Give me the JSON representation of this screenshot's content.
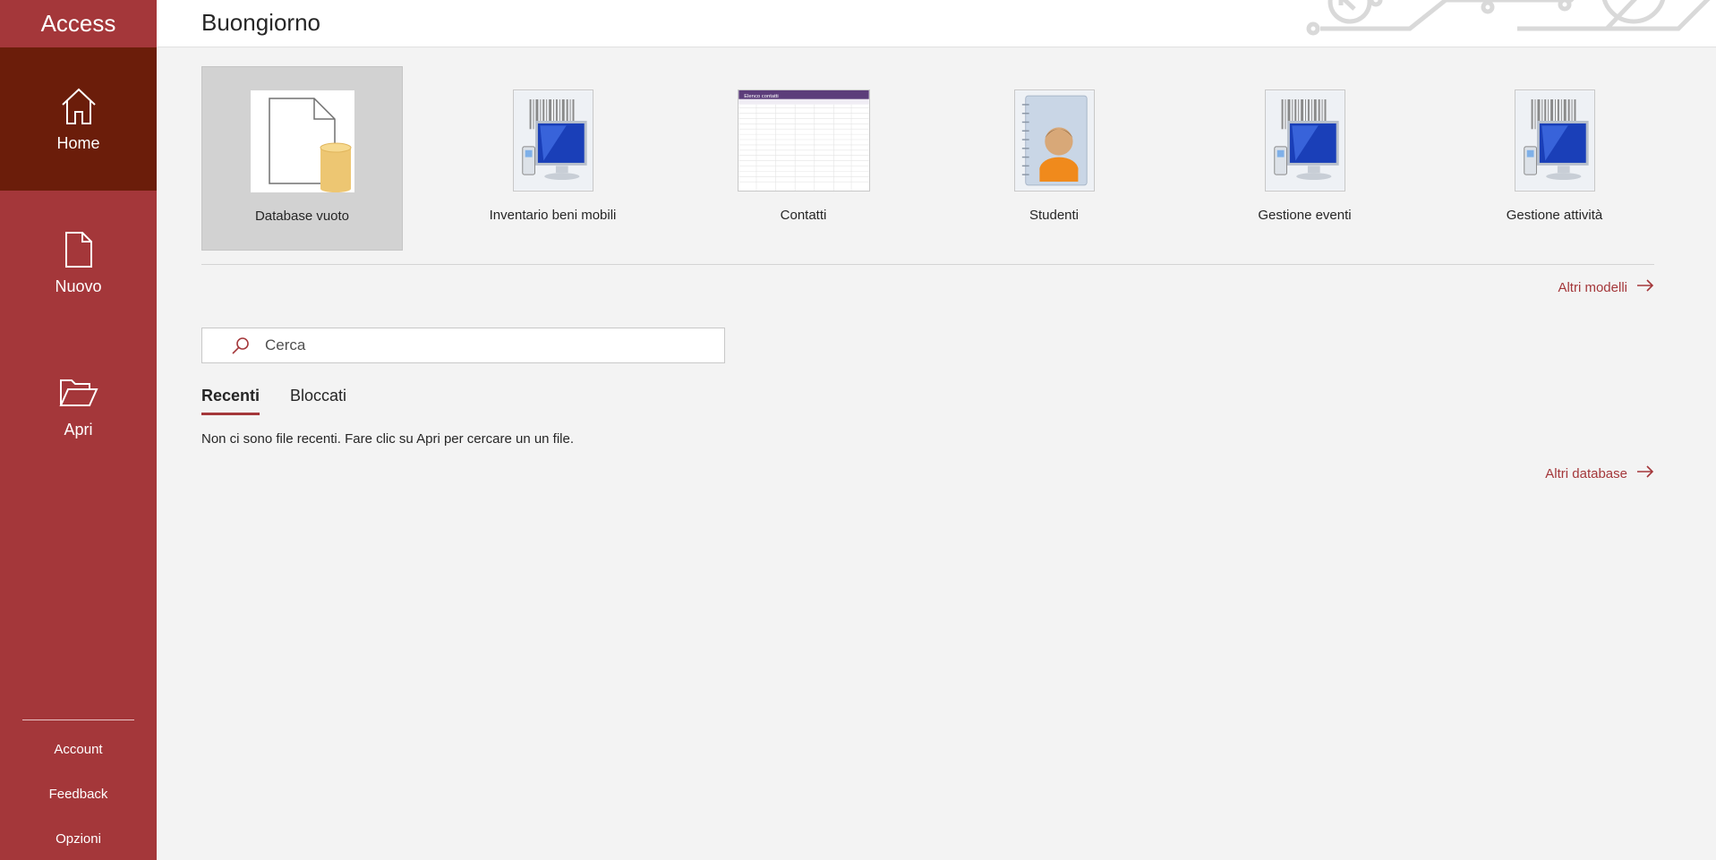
{
  "app": {
    "title": "Access"
  },
  "nav": {
    "home": "Home",
    "new": "Nuovo",
    "open": "Apri"
  },
  "sidebar_footer": {
    "account": "Account",
    "feedback": "Feedback",
    "options": "Opzioni"
  },
  "header": {
    "greeting": "Buongiorno"
  },
  "templates": [
    {
      "label": "Database vuoto",
      "icon": "blank-database-icon"
    },
    {
      "label": "Inventario beni mobili",
      "icon": "barcode-computer-icon"
    },
    {
      "label": "Contatti",
      "icon": "contacts-table-icon",
      "thumb_title": "Elenco contatti"
    },
    {
      "label": "Studenti",
      "icon": "student-notebook-icon"
    },
    {
      "label": "Gestione eventi",
      "icon": "barcode-computer-icon"
    },
    {
      "label": "Gestione attività",
      "icon": "barcode-computer-icon"
    }
  ],
  "links": {
    "more_templates": "Altri modelli",
    "more_databases": "Altri database"
  },
  "search": {
    "placeholder": "Cerca",
    "value": ""
  },
  "tabs": {
    "recent": "Recenti",
    "pinned": "Bloccati"
  },
  "recent": {
    "empty_message": "Non ci sono file recenti. Fare clic su Apri per cercare un un file."
  },
  "colors": {
    "accent": "#a4373a",
    "active_nav": "#6b1d0a",
    "background": "#f3f3f3"
  }
}
